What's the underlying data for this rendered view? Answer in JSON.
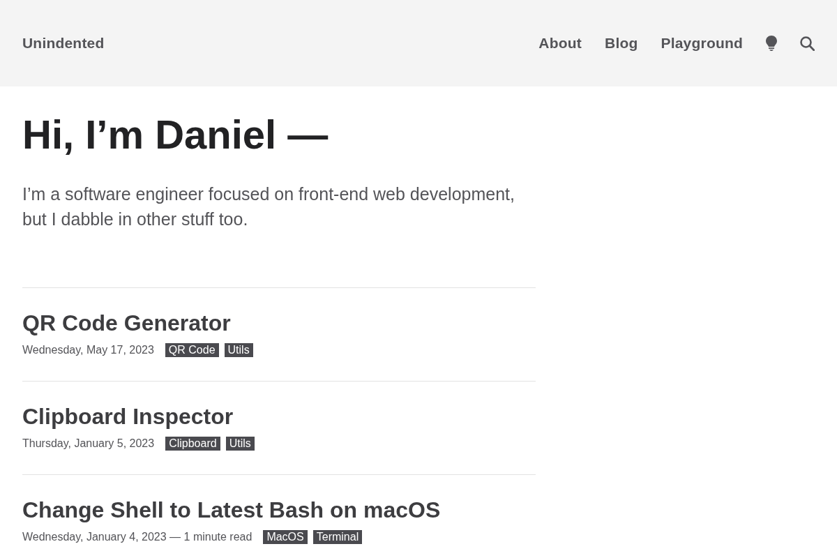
{
  "header": {
    "logo": "Unindented",
    "nav": [
      {
        "label": "About"
      },
      {
        "label": "Blog"
      },
      {
        "label": "Playground"
      }
    ],
    "actions": [
      {
        "kind": "theme"
      },
      {
        "kind": "search"
      }
    ]
  },
  "intro": {
    "title": "Hi, I’m Daniel —",
    "text": "I’m a software engineer focused on front-end web development, but I dabble in other stuff too."
  },
  "posts": [
    {
      "title": "QR Code Generator",
      "meta": "Wednesday, May 17, 2023",
      "tags": [
        "QR Code",
        "Utils"
      ]
    },
    {
      "title": "Clipboard Inspector",
      "meta": "Thursday, January 5, 2023",
      "tags": [
        "Clipboard",
        "Utils"
      ]
    },
    {
      "title": "Change Shell to Latest Bash on macOS",
      "meta": "Wednesday, January 4, 2023 — 1 minute read",
      "tags": [
        "MacOS",
        "Terminal"
      ]
    }
  ]
}
